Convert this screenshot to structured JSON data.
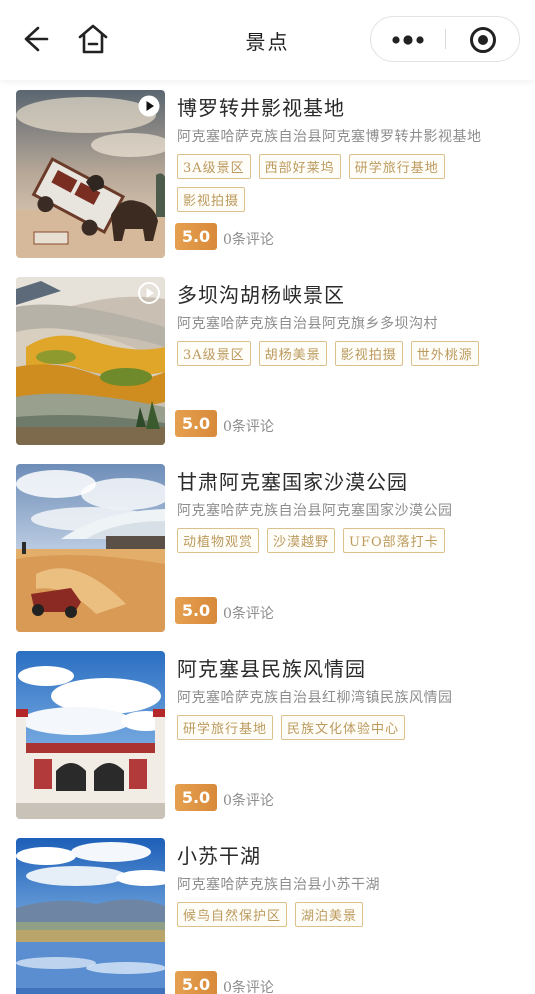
{
  "header": {
    "title": "景点",
    "icons": {
      "back": "back-arrow-icon",
      "home": "home-icon",
      "more": "more-dots-icon",
      "close": "target-icon"
    }
  },
  "scenic_spots": [
    {
      "title": "博罗转井影视基地",
      "address": "阿克塞哈萨克族自治县阿克塞博罗转井影视基地",
      "tags": [
        "3A级景区",
        "西部好莱坞",
        "研学旅行基地",
        "影视拍摄"
      ],
      "rating": "5.0",
      "reviews": "0条评论",
      "has_video": true
    },
    {
      "title": "多坝沟胡杨峡景区",
      "address": "阿克塞哈萨克族自治县阿克旗乡多坝沟村",
      "tags": [
        "3A级景区",
        "胡杨美景",
        "影视拍摄",
        "世外桃源"
      ],
      "rating": "5.0",
      "reviews": "0条评论",
      "has_video": true
    },
    {
      "title": "甘肃阿克塞国家沙漠公园",
      "address": "阿克塞哈萨克族自治县阿克塞国家沙漠公园",
      "tags": [
        "动植物观赏",
        "沙漠越野",
        "UFO部落打卡"
      ],
      "rating": "5.0",
      "reviews": "0条评论",
      "has_video": false
    },
    {
      "title": "阿克塞县民族风情园",
      "address": "阿克塞哈萨克族自治县红柳湾镇民族风情园",
      "tags": [
        "研学旅行基地",
        "民族文化体验中心"
      ],
      "rating": "5.0",
      "reviews": "0条评论",
      "has_video": false
    },
    {
      "title": "小苏干湖",
      "address": "阿克塞哈萨克族自治县小苏干湖",
      "tags": [
        "候鸟自然保护区",
        "湖泊美景"
      ],
      "rating": "5.0",
      "reviews": "0条评论",
      "has_video": false
    }
  ],
  "colors": {
    "tag_border": "#dcc18e",
    "tag_text": "#bc9a5e",
    "rating_bg": "#e09645",
    "secondary_text": "#8d8d8d"
  }
}
